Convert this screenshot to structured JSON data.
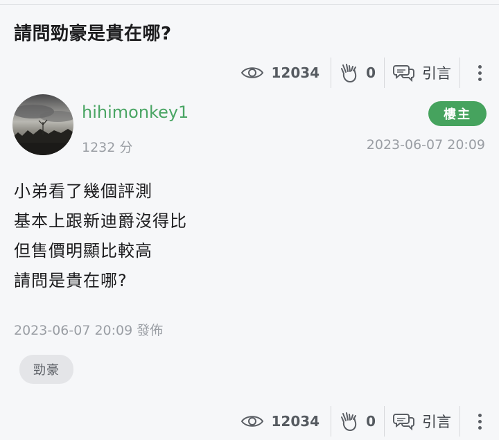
{
  "post": {
    "title": "請問勁豪是貴在哪?",
    "stats": {
      "views": "12034",
      "claps": "0",
      "quote_label": "引言"
    },
    "author": {
      "name": "hihimonkey1",
      "score": "1232 分",
      "badge": "樓主"
    },
    "timestamp": "2023-06-07 20:09",
    "content_lines": [
      "小弟看了幾個評測",
      "基本上跟新迪爵沒得比",
      "但售價明顯比較高",
      "請問是貴在哪?"
    ],
    "published": "2023-06-07 20:09 發佈",
    "tags": [
      "勁豪"
    ]
  },
  "icons": {
    "views": "eye-icon",
    "claps": "clap-hands-icon",
    "quote": "speech-bubbles-icon",
    "more": "more-vertical-icon"
  },
  "colors": {
    "author": "#4aa564",
    "badge": "#46a35e",
    "meta": "#9a9ea4"
  }
}
